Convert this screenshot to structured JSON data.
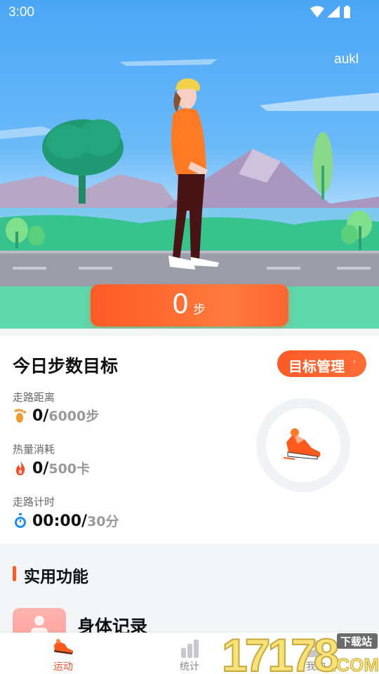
{
  "status_bar": {
    "time": "3:00"
  },
  "header": {
    "username": "aukl"
  },
  "steps": {
    "count": "0",
    "unit": "步"
  },
  "goal_card": {
    "title": "今日步数目标",
    "manage_button": "目标管理",
    "distance": {
      "label": "走路距离",
      "value": "0/",
      "goal": "6000步"
    },
    "calories": {
      "label": "热量消耗",
      "value": "0/",
      "goal": "500卡"
    },
    "time": {
      "label": "走路计时",
      "value": "00:00/",
      "goal": "30分"
    },
    "progress": 0
  },
  "features": {
    "title": "实用功能",
    "items": [
      {
        "label": "身体记录"
      }
    ]
  },
  "nav": {
    "tabs": [
      {
        "label": "运动",
        "active": true
      },
      {
        "label": "统计",
        "active": false
      },
      {
        "label": "我的",
        "active": false
      }
    ]
  },
  "watermark": {
    "text": "17178",
    "tag": "下载站",
    "domain": ".COM"
  },
  "colors": {
    "accent": "#ff5a26",
    "sky": "#4ba6f6",
    "road": "#9a9ca8",
    "grass": "#37c48f"
  },
  "icons": {
    "status": [
      "wifi-icon",
      "signal-icon",
      "battery-icon"
    ]
  }
}
